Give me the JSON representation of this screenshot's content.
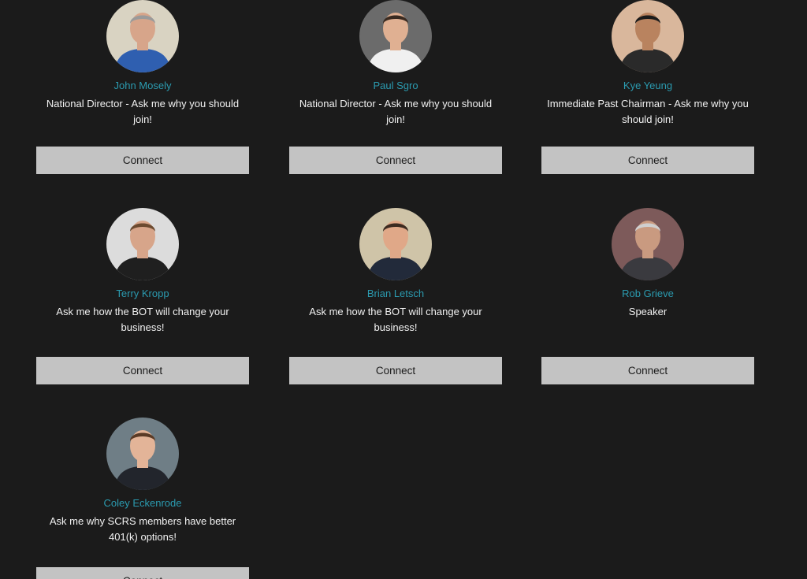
{
  "profiles": [
    {
      "name": "John Mosely",
      "title": "National Director - Ask me why you should join!",
      "button": "Connect",
      "avatar_icon": "person-photo-icon",
      "bg": "#d9d3c2",
      "shirt": "#2f5fb0",
      "skin": "#d7a58a",
      "hair": "#9a9a9a"
    },
    {
      "name": "Paul Sgro",
      "title": "National Director - Ask me why you should join!",
      "button": "Connect",
      "avatar_icon": "person-photo-icon",
      "bg": "#6b6b6b",
      "shirt": "#f0f0f0",
      "skin": "#e0b092",
      "hair": "#3a2a20"
    },
    {
      "name": "Kye Yeung",
      "title": "Immediate Past Chairman - Ask me why you should join!",
      "button": "Connect",
      "avatar_icon": "person-photo-icon",
      "bg": "#d9b79c",
      "shirt": "#2a2a2a",
      "skin": "#b9835f",
      "hair": "#1b1b1b"
    },
    {
      "name": "Terry Kropp",
      "title": "Ask me how the BOT will change your business!",
      "button": "Connect",
      "avatar_icon": "person-photo-icon",
      "bg": "#dcdcdc",
      "shirt": "#1f1f1f",
      "skin": "#d7a58a",
      "hair": "#6b4a30"
    },
    {
      "name": "Brian Letsch",
      "title": "Ask me how the BOT will change your business!",
      "button": "Connect",
      "avatar_icon": "person-photo-icon",
      "bg": "#cfc4a8",
      "shirt": "#222a3a",
      "skin": "#e0a888",
      "hair": "#3b2a20"
    },
    {
      "name": "Rob Grieve",
      "title": "Speaker",
      "button": "Connect",
      "avatar_icon": "person-photo-icon",
      "bg": "#7d5a5a",
      "shirt": "#3a3a3f",
      "skin": "#c99a80",
      "hair": "#cfcfcf"
    },
    {
      "name": "Coley Eckenrode",
      "title": "Ask me why SCRS members have better 401(k) options!",
      "button": "Connect",
      "avatar_icon": "person-photo-icon",
      "bg": "#6f7e86",
      "shirt": "#22252c",
      "skin": "#e3b498",
      "hair": "#5a3a25"
    }
  ]
}
